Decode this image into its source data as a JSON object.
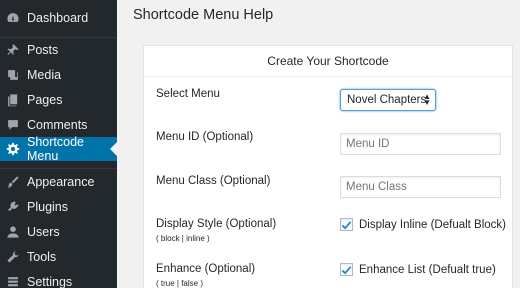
{
  "sidebar": {
    "items": [
      {
        "label": "Dashboard",
        "icon": "dashboard-icon"
      },
      {
        "label": "Posts",
        "icon": "pin-icon"
      },
      {
        "label": "Media",
        "icon": "media-icon"
      },
      {
        "label": "Pages",
        "icon": "pages-icon"
      },
      {
        "label": "Comments",
        "icon": "comments-icon"
      },
      {
        "label": "Shortcode Menu",
        "icon": "gear-icon",
        "active": true
      },
      {
        "label": "Appearance",
        "icon": "brush-icon"
      },
      {
        "label": "Plugins",
        "icon": "plugin-icon"
      },
      {
        "label": "Users",
        "icon": "users-icon"
      },
      {
        "label": "Tools",
        "icon": "wrench-icon"
      },
      {
        "label": "Settings",
        "icon": "settings-icon"
      }
    ]
  },
  "page": {
    "title": "Shortcode Menu Help"
  },
  "panel": {
    "title": "Create Your Shortcode",
    "select_menu": {
      "label": "Select Menu",
      "value": "Novel Chapters"
    },
    "menu_id": {
      "label": "Menu ID (Optional)",
      "placeholder": "Menu ID"
    },
    "menu_class": {
      "label": "Menu Class (Optional)",
      "placeholder": "Menu Class"
    },
    "display_style": {
      "label": "Display Style (Optional)",
      "hint": "( block | inline )",
      "checkbox_label": "Display Inline (Defualt Block)",
      "checked": true
    },
    "enhance": {
      "label": "Enhance (Optional)",
      "hint": "( true | false )",
      "checkbox_label": "Enhance List (Defualt true)",
      "checked": true
    }
  },
  "colors": {
    "sidebar_bg": "#23282d",
    "active_bg": "#0073aa",
    "check": "#1e8cbe"
  }
}
